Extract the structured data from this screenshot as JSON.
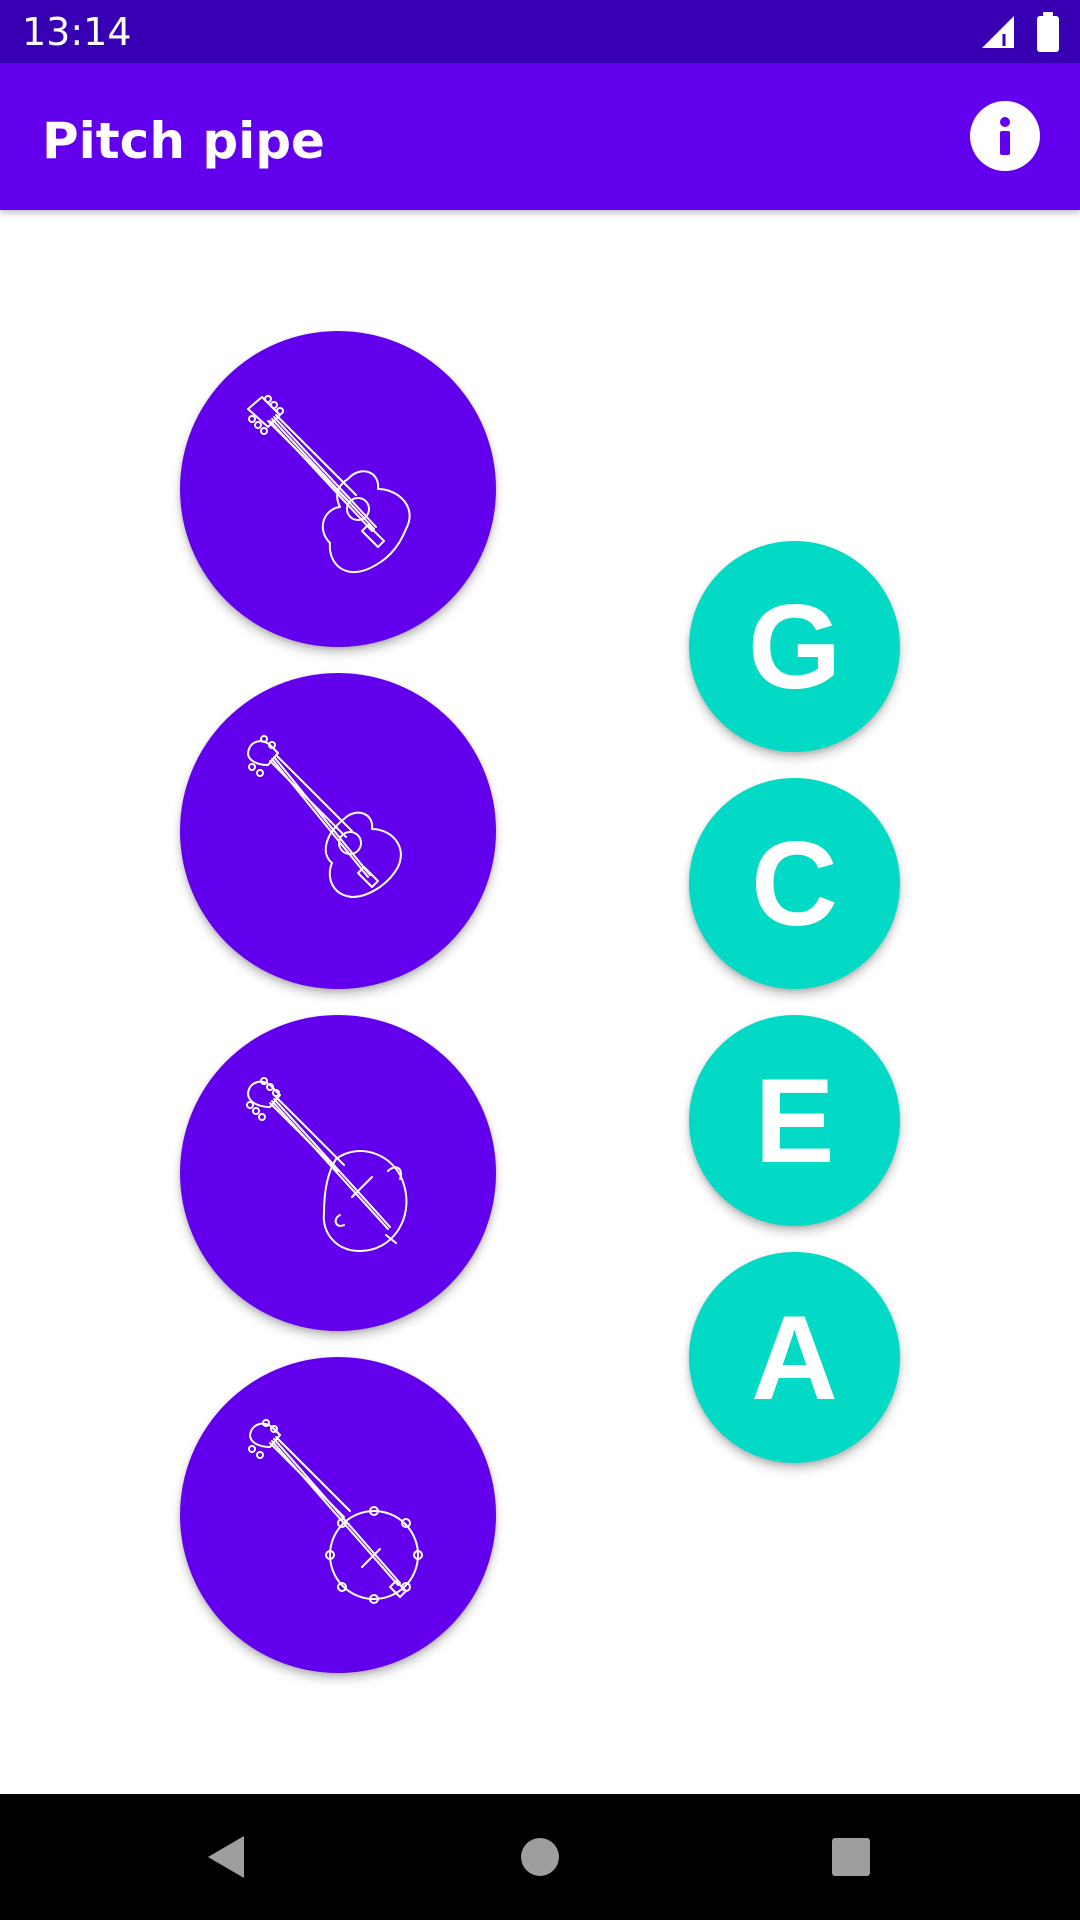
{
  "status_bar": {
    "time": "13:14",
    "icons": [
      "signal-icon",
      "battery-icon"
    ]
  },
  "app_bar": {
    "title": "Pitch pipe",
    "action_icon": "info-icon"
  },
  "instruments": [
    {
      "icon": "guitar-icon"
    },
    {
      "icon": "ukulele-icon"
    },
    {
      "icon": "mandolin-icon"
    },
    {
      "icon": "banjo-icon"
    }
  ],
  "notes": [
    {
      "label": "G"
    },
    {
      "label": "C"
    },
    {
      "label": "E"
    },
    {
      "label": "A"
    }
  ],
  "nav_bar": {
    "buttons": [
      "back-icon",
      "home-icon",
      "recents-icon"
    ]
  },
  "colors": {
    "status_bar": "#3700b3",
    "primary": "#6200ee",
    "accent": "#03dac5",
    "background": "#ffffff",
    "nav_bar": "#000000"
  }
}
